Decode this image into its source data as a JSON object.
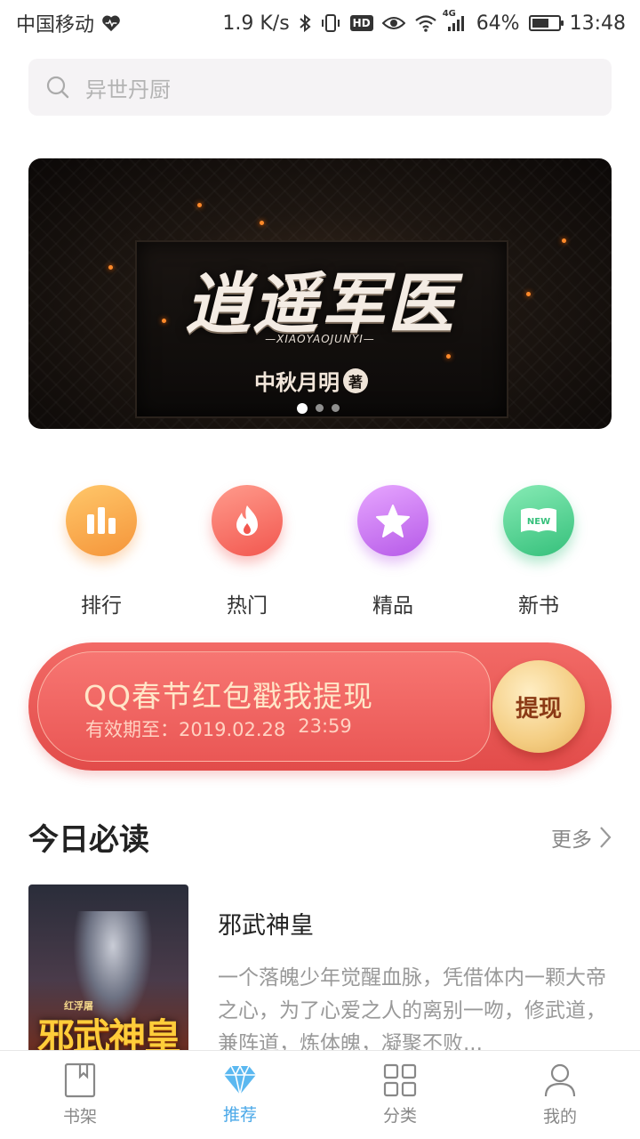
{
  "status_bar": {
    "carrier": "中国移动",
    "speed": "1.9 K/s",
    "hd": "HD",
    "network": "4G",
    "battery_percent": "64%",
    "battery_level": 0.64,
    "time": "13:48"
  },
  "search": {
    "placeholder": "异世丹厨"
  },
  "banner": {
    "title": "逍遥军医",
    "pinyin": "—XIAOYAOJUNYI—",
    "author": "中秋月明",
    "author_seal": "著",
    "page_count": 3,
    "active_page": 1
  },
  "categories": [
    {
      "label": "排行",
      "icon": "bar-chart-icon",
      "color": "#f5953a"
    },
    {
      "label": "热门",
      "icon": "flame-icon",
      "color": "#f2574f"
    },
    {
      "label": "精品",
      "icon": "star-icon",
      "color": "#b65ae8"
    },
    {
      "label": "新书",
      "icon": "new-book-icon",
      "color": "#35c07b",
      "badge": "NEW"
    }
  ],
  "red_packet": {
    "title": "QQ春节红包戳我提现",
    "validity_label": "有效期至：",
    "validity_date": "2019.02.28",
    "validity_time": "23:59",
    "button": "提现"
  },
  "today": {
    "title": "今日必读",
    "more": "更多",
    "book": {
      "title": "邪武神皇",
      "description": "一个落魄少年觉醒血脉，凭借体内一颗大帝之心，为了心爱之人的离别一吻，修武道，兼阵道，炼体魄，凝聚不败...",
      "cover_title": "邪武神皇",
      "cover_publisher": "红浮屠"
    }
  },
  "bottom_nav": [
    {
      "label": "书架",
      "icon": "bookshelf-icon",
      "active": false
    },
    {
      "label": "推荐",
      "icon": "diamond-icon",
      "active": true
    },
    {
      "label": "分类",
      "icon": "grid-icon",
      "active": false
    },
    {
      "label": "我的",
      "icon": "person-icon",
      "active": false
    }
  ],
  "colors": {
    "accent": "#4aa8e8",
    "red_packet": "#e24c4a",
    "gold_button": "#f4cd82"
  }
}
